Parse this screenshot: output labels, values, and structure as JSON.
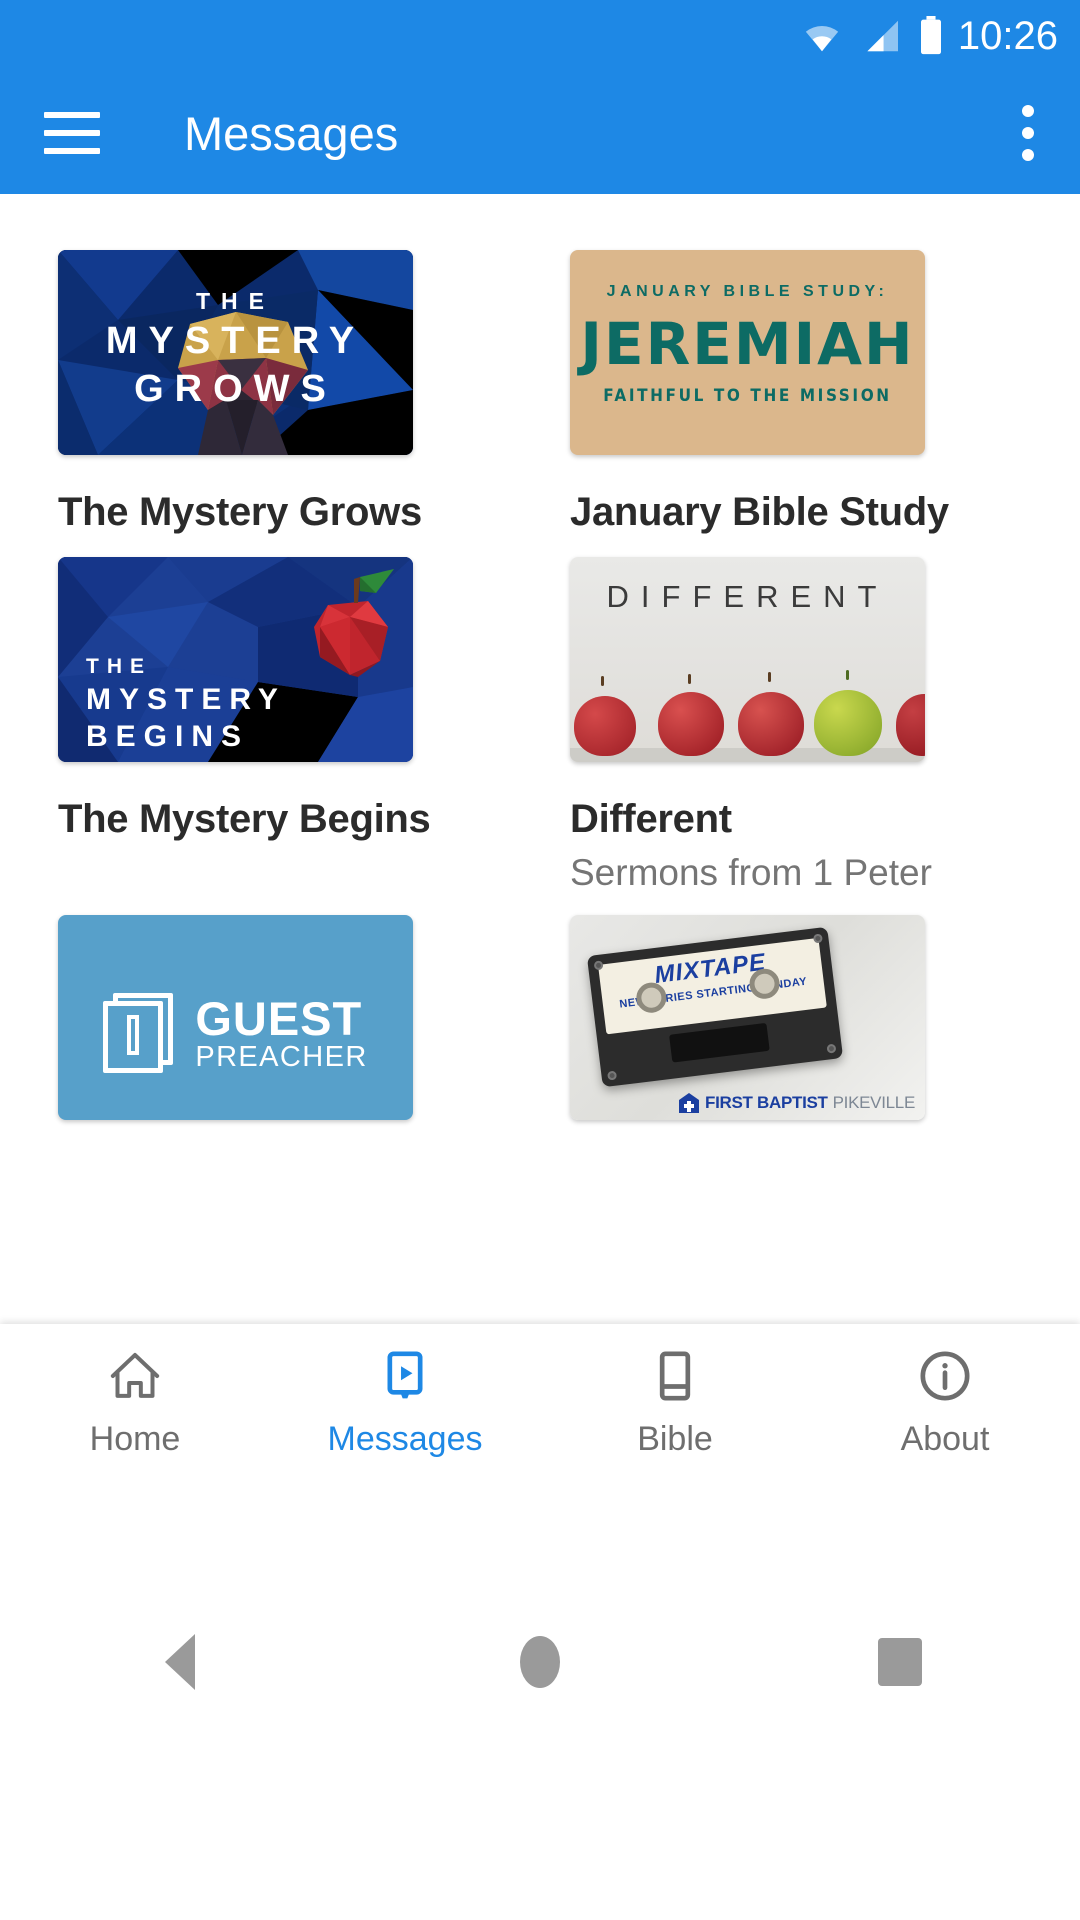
{
  "status_bar": {
    "time": "10:26",
    "icons": [
      "wifi-icon",
      "cellular-signal-icon",
      "battery-icon"
    ]
  },
  "app_bar": {
    "menu_icon": "hamburger-menu-icon",
    "title": "Messages",
    "overflow_icon": "more-vertical-icon"
  },
  "messages": [
    {
      "title": "The Mystery Grows",
      "subtitle": "",
      "thumb": {
        "style": "low-poly-navy",
        "line1": "THE",
        "line2": "MYSTERY",
        "line3": "GROWS",
        "bg_color": "#0b2a6b",
        "text_color": "#ffffff"
      }
    },
    {
      "title": "January Bible Study",
      "subtitle": "",
      "thumb": {
        "style": "tan-poster",
        "line1": "JANUARY BIBLE STUDY:",
        "line2": "JEREMIAH",
        "line3": "FAITHFUL TO THE MISSION",
        "bg_color": "#dbb78c",
        "text_color": "#0d6b64"
      }
    },
    {
      "title": "The Mystery Begins",
      "subtitle": "",
      "thumb": {
        "style": "low-poly-blue-apple",
        "line1": "THE",
        "line2": "MYSTERY",
        "line3": "BEGINS",
        "bg_color": "#1c3f94",
        "text_color": "#ffffff"
      }
    },
    {
      "title": "Different",
      "subtitle": "Sermons from 1 Peter",
      "thumb": {
        "style": "apples-photo",
        "line1": "DIFFERENT",
        "line2": "",
        "line3": "",
        "bg_color": "#e6e5e2",
        "text_color": "#3b3b3b"
      }
    },
    {
      "title": "",
      "subtitle": "",
      "thumb": {
        "style": "guest-preacher-blue",
        "line1": "GUEST",
        "line2": "PREACHER",
        "line3": "",
        "bg_color": "#57a0ca",
        "text_color": "#ffffff"
      }
    },
    {
      "title": "",
      "subtitle": "",
      "thumb": {
        "style": "mixtape-photo",
        "line1": "MIXTAPE",
        "line2": "NEW SERIES STARTING SUNDAY",
        "line3": "FIRST BAPTIST",
        "line4": "PIKEVILLE",
        "bg_color": "#e6e5e2",
        "text_color": "#1b3fa0"
      }
    }
  ],
  "bottom_nav": {
    "active_color": "#1E88E5",
    "inactive_color": "#6e6e6e",
    "items": [
      {
        "label": "Home",
        "icon": "home-icon",
        "active": false
      },
      {
        "label": "Messages",
        "icon": "video-message-icon",
        "active": true
      },
      {
        "label": "Bible",
        "icon": "book-icon",
        "active": false
      },
      {
        "label": "About",
        "icon": "info-circle-icon",
        "active": false
      }
    ]
  },
  "android_nav": {
    "back": "back-triangle-icon",
    "home": "home-circle-icon",
    "recents": "recents-square-icon"
  },
  "theme": {
    "primary": "#1E88E5",
    "background": "#ffffff",
    "title_text": "#2b2b2b",
    "subtitle_text": "#757575"
  }
}
